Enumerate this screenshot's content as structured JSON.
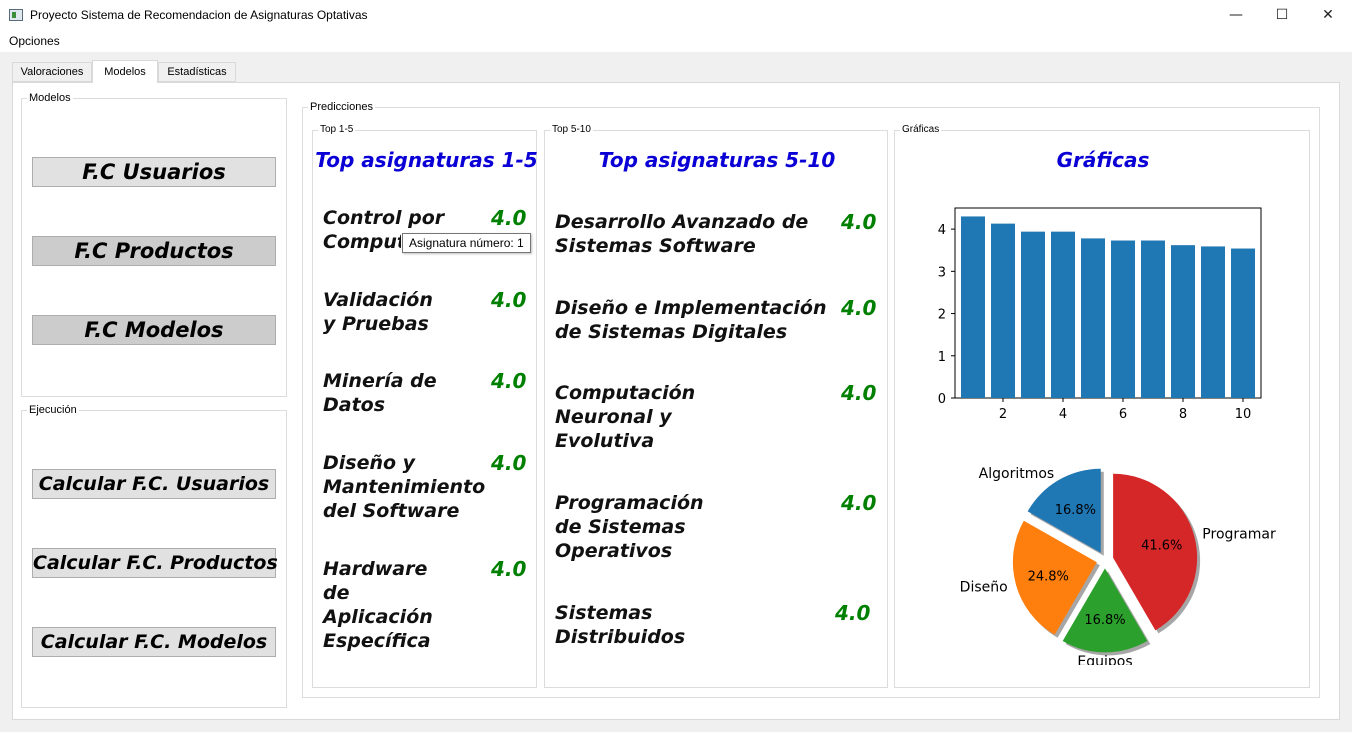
{
  "window": {
    "title": "Proyecto Sistema de Recomendacion de Asignaturas Optativas"
  },
  "menu": {
    "opciones": "Opciones"
  },
  "tabs": [
    "Valoraciones",
    "Modelos",
    "Estadísticas"
  ],
  "modelos": {
    "group_title": "Modelos",
    "buttons": [
      "F.C Usuarios",
      "F.C Productos",
      "F.C Modelos"
    ]
  },
  "ejecucion": {
    "group_title": "Ejecución",
    "buttons": [
      "Calcular F.C. Usuarios",
      "Calcular F.C. Productos",
      "Calcular F.C. Modelos"
    ]
  },
  "predicciones": {
    "group_title": "Predicciones",
    "top1_5": {
      "group_title": "Top 1-5",
      "header": "Top asignaturas 1-5",
      "items": [
        {
          "lines": [
            "Control por",
            "Computadores"
          ],
          "score": "4.0"
        },
        {
          "lines": [
            "Validación",
            "y Pruebas"
          ],
          "score": "4.0"
        },
        {
          "lines": [
            "Minería de",
            "Datos"
          ],
          "score": "4.0"
        },
        {
          "lines": [
            "Diseño y",
            "Mantenimiento",
            "del Software"
          ],
          "score": "4.0"
        },
        {
          "lines": [
            "Hardware",
            "de",
            "Aplicación",
            "Específica"
          ],
          "score": "4.0"
        }
      ]
    },
    "top5_10": {
      "group_title": "Top 5-10",
      "header": "Top asignaturas 5-10",
      "items": [
        {
          "lines": [
            "Desarrollo Avanzado de",
            "Sistemas Software"
          ],
          "score": "4.0"
        },
        {
          "lines": [
            "Diseño e Implementación",
            "de Sistemas Digitales"
          ],
          "score": "4.0"
        },
        {
          "lines": [
            "Computación",
            "Neuronal y",
            "Evolutiva"
          ],
          "score": "4.0"
        },
        {
          "lines": [
            "Programación",
            "de Sistemas",
            "Operativos"
          ],
          "score": "4.0"
        },
        {
          "lines": [
            "Sistemas",
            "Distribuidos"
          ],
          "score": "4.0"
        }
      ]
    },
    "graficas": {
      "group_title": "Gráficas",
      "header": "Gráficas"
    }
  },
  "tooltip": "Asignatura número: 1",
  "chart_data": [
    {
      "type": "bar",
      "x": [
        1,
        2,
        3,
        4,
        5,
        6,
        7,
        8,
        9,
        10
      ],
      "values": [
        4.3,
        4.13,
        3.94,
        3.94,
        3.78,
        3.73,
        3.73,
        3.62,
        3.59,
        3.54
      ],
      "xticks": [
        2,
        4,
        6,
        8,
        10
      ],
      "yticks": [
        0,
        1,
        2,
        3,
        4
      ],
      "ylim": [
        0,
        4.5
      ],
      "xlim": [
        0.4,
        10.6
      ],
      "color": "#1f77b4"
    },
    {
      "type": "pie",
      "labels": [
        "Algoritmos",
        "Diseño",
        "Equipos",
        "Programar"
      ],
      "values": [
        16.8,
        24.8,
        16.8,
        41.6
      ],
      "value_labels": [
        "16.8%",
        "24.8%",
        "16.8%",
        "41.6%"
      ],
      "colors": [
        "#1f77b4",
        "#ff7f0e",
        "#2ca02c",
        "#d62728"
      ],
      "start_angle_deg": 90,
      "exploded": true,
      "shadow": true
    }
  ]
}
